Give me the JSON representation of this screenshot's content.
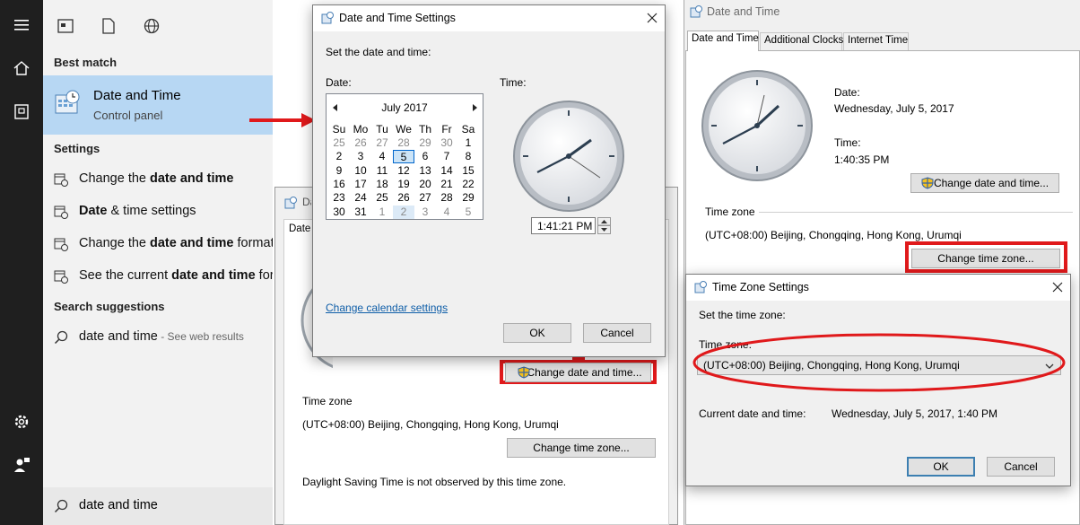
{
  "start_menu": {
    "best_match_heading": "Best match",
    "best_match_title": "Date and Time",
    "best_match_subtitle": "Control panel",
    "settings_heading": "Settings",
    "settings_items": [
      {
        "pre": "Change the ",
        "bold": "date and time",
        "post": ""
      },
      {
        "pre": "",
        "bold": "Date",
        "post": " & time settings"
      },
      {
        "pre": "Change the ",
        "bold": "date and time",
        "post": " format"
      },
      {
        "pre": "See the current ",
        "bold": "date and time",
        "post": " format"
      }
    ],
    "suggestions_heading": "Search suggestions",
    "suggestion_text": "date and time",
    "suggestion_hint": " - See web results",
    "search_value": "date and time"
  },
  "back_dialog": {
    "title": "Date and Time",
    "tab": "Date and Time",
    "time_zone_heading": "Time zone",
    "time_zone_value": "(UTC+08:00) Beijing, Chongqing, Hong Kong, Urumqi",
    "change_date_time_button": "Change date and time...",
    "change_time_zone_button": "Change time zone...",
    "dst_note": "Daylight Saving Time is not observed by this time zone."
  },
  "right_dialog": {
    "title": "Date and Time",
    "tabs": [
      "Date and Time",
      "Additional Clocks",
      "Internet Time"
    ],
    "date_label": "Date:",
    "date_value": "Wednesday, July 5, 2017",
    "time_label": "Time:",
    "time_value": "1:40:35 PM",
    "change_date_time_button": "Change date and time...",
    "time_zone_heading": "Time zone",
    "time_zone_value": "(UTC+08:00) Beijing, Chongqing, Hong Kong, Urumqi",
    "change_time_zone_button": "Change time zone..."
  },
  "date_time_settings": {
    "title": "Date and Time Settings",
    "instruction": "Set the date and time:",
    "date_label": "Date:",
    "time_label": "Time:",
    "month_label": "July 2017",
    "day_headers": [
      "Su",
      "Mo",
      "Tu",
      "We",
      "Th",
      "Fr",
      "Sa"
    ],
    "weeks": [
      [
        "25",
        "26",
        "27",
        "28",
        "29",
        "30",
        "1"
      ],
      [
        "2",
        "3",
        "4",
        "5",
        "6",
        "7",
        "8"
      ],
      [
        "9",
        "10",
        "11",
        "12",
        "13",
        "14",
        "15"
      ],
      [
        "16",
        "17",
        "18",
        "19",
        "20",
        "21",
        "22"
      ],
      [
        "23",
        "24",
        "25",
        "26",
        "27",
        "28",
        "29"
      ],
      [
        "30",
        "31",
        "1",
        "2",
        "3",
        "4",
        "5"
      ]
    ],
    "time_value": "1:41:21 PM",
    "calendar_link": "Change calendar settings",
    "ok_button": "OK",
    "cancel_button": "Cancel"
  },
  "time_zone_settings": {
    "title": "Time Zone Settings",
    "instruction": "Set the time zone:",
    "time_zone_label": "Time zone:",
    "time_zone_selected": "(UTC+08:00) Beijing, Chongqing, Hong Kong, Urumqi",
    "current_label": "Current date and time:",
    "current_value": "Wednesday, July 5, 2017, 1:40 PM",
    "ok_button": "OK",
    "cancel_button": "Cancel"
  },
  "colors": {
    "highlight_red": "#e0191b",
    "best_match_bg": "#b7d7f3",
    "rail_bg": "#1f1f1f"
  }
}
